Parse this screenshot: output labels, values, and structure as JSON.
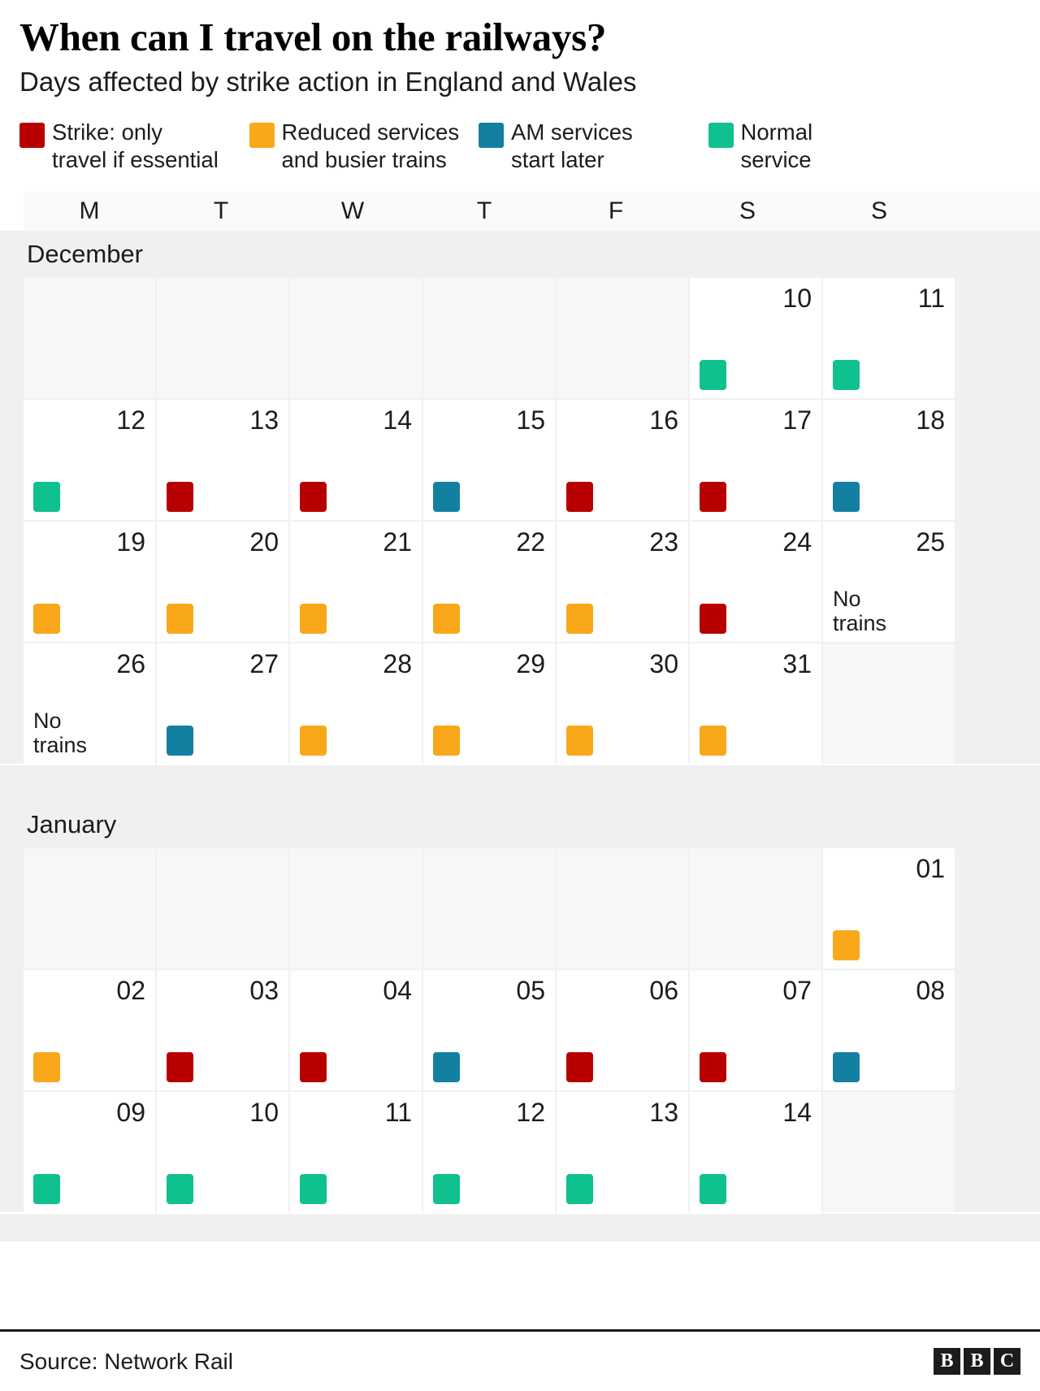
{
  "header": {
    "title": "When can I travel on the railways?",
    "subtitle": "Days affected by strike action in England and Wales"
  },
  "colors": {
    "strike": "#B80000",
    "reduced": "#F9A81A",
    "am_later": "#1380A1",
    "normal": "#0FC18E",
    "empty_cell": "#F7F7F7",
    "cell": "#FFFFFF",
    "band": "#F0F0F0",
    "text": "#1C1C1C"
  },
  "legend": [
    {
      "key": "strike",
      "color": "#B80000",
      "label": "Strike: only\ntravel if essential"
    },
    {
      "key": "reduced",
      "color": "#F9A81A",
      "label": "Reduced services\nand busier trains"
    },
    {
      "key": "am_later",
      "color": "#1380A1",
      "label": "AM services\nstart later"
    },
    {
      "key": "normal",
      "color": "#0FC18E",
      "label": "Normal\nservice"
    }
  ],
  "day_headers": [
    "M",
    "T",
    "W",
    "T",
    "F",
    "S",
    "S"
  ],
  "months": [
    {
      "name": "December",
      "weeks": [
        [
          {
            "empty": true
          },
          {
            "empty": true
          },
          {
            "empty": true
          },
          {
            "empty": true
          },
          {
            "empty": true
          },
          {
            "day": "10",
            "status": "normal"
          },
          {
            "day": "11",
            "status": "normal"
          }
        ],
        [
          {
            "day": "12",
            "status": "normal"
          },
          {
            "day": "13",
            "status": "strike"
          },
          {
            "day": "14",
            "status": "strike"
          },
          {
            "day": "15",
            "status": "am_later"
          },
          {
            "day": "16",
            "status": "strike"
          },
          {
            "day": "17",
            "status": "strike"
          },
          {
            "day": "18",
            "status": "am_later"
          }
        ],
        [
          {
            "day": "19",
            "status": "reduced"
          },
          {
            "day": "20",
            "status": "reduced"
          },
          {
            "day": "21",
            "status": "reduced"
          },
          {
            "day": "22",
            "status": "reduced"
          },
          {
            "day": "23",
            "status": "reduced"
          },
          {
            "day": "24",
            "status": "strike"
          },
          {
            "day": "25",
            "status": "none",
            "note": "No\ntrains"
          }
        ],
        [
          {
            "day": "26",
            "status": "none",
            "note": "No\ntrains"
          },
          {
            "day": "27",
            "status": "am_later"
          },
          {
            "day": "28",
            "status": "reduced"
          },
          {
            "day": "29",
            "status": "reduced"
          },
          {
            "day": "30",
            "status": "reduced"
          },
          {
            "day": "31",
            "status": "reduced"
          },
          {
            "empty": true
          }
        ]
      ]
    },
    {
      "name": "January",
      "weeks": [
        [
          {
            "empty": true
          },
          {
            "empty": true
          },
          {
            "empty": true
          },
          {
            "empty": true
          },
          {
            "empty": true
          },
          {
            "empty": true
          },
          {
            "day": "01",
            "status": "reduced"
          }
        ],
        [
          {
            "day": "02",
            "status": "reduced"
          },
          {
            "day": "03",
            "status": "strike"
          },
          {
            "day": "04",
            "status": "strike"
          },
          {
            "day": "05",
            "status": "am_later"
          },
          {
            "day": "06",
            "status": "strike"
          },
          {
            "day": "07",
            "status": "strike"
          },
          {
            "day": "08",
            "status": "am_later"
          }
        ],
        [
          {
            "day": "09",
            "status": "normal"
          },
          {
            "day": "10",
            "status": "normal"
          },
          {
            "day": "11",
            "status": "normal"
          },
          {
            "day": "12",
            "status": "normal"
          },
          {
            "day": "13",
            "status": "normal"
          },
          {
            "day": "14",
            "status": "normal"
          },
          {
            "empty": true
          }
        ]
      ]
    }
  ],
  "footer": {
    "source": "Source: Network Rail",
    "logo": [
      "B",
      "B",
      "C"
    ]
  }
}
